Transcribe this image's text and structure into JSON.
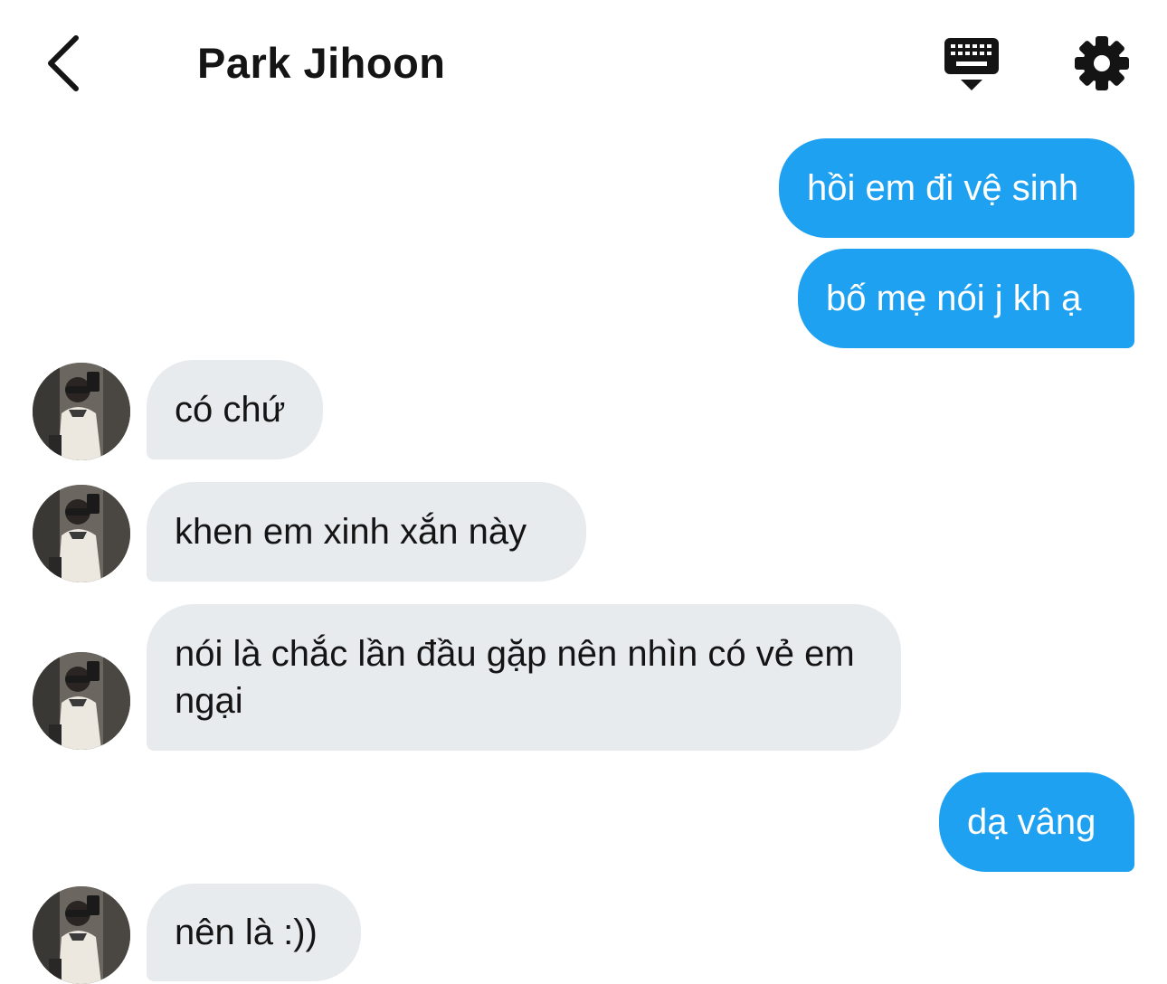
{
  "header": {
    "title": "Park Jihoon",
    "back_icon": "chevron-left-icon",
    "keyboard_icon": "keyboard-icon",
    "settings_icon": "gear-icon"
  },
  "colors": {
    "outgoing_bubble": "#1fa1f1",
    "incoming_bubble": "#e7ebee",
    "text": "#141414"
  },
  "messages": [
    {
      "direction": "out",
      "text": "hồi em đi vệ sinh"
    },
    {
      "direction": "out",
      "text": "bố mẹ nói j kh ạ"
    },
    {
      "direction": "in",
      "text": "có chứ"
    },
    {
      "direction": "in",
      "text": "khen em xinh xắn này"
    },
    {
      "direction": "in",
      "text": "nói là chắc lần đầu gặp nên nhìn có vẻ em ngại"
    },
    {
      "direction": "out",
      "text": "dạ vâng"
    },
    {
      "direction": "in",
      "text": "nên là :))"
    }
  ]
}
